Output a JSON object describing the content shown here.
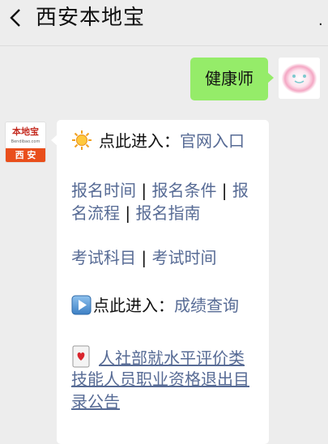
{
  "header": {
    "title": "西安本地宝",
    "more": "."
  },
  "user_message": {
    "text": "健康师"
  },
  "bot_avatar": {
    "name": "本地宝",
    "site": "Bendibao.com",
    "city": "西 安"
  },
  "bot_message": {
    "line1": {
      "prefix": "点此进入：",
      "link": "官网入口"
    },
    "line2": {
      "a": "报名时间",
      "sep1": " | ",
      "b": "报名条件",
      "sep2": " | ",
      "c_part1": "报"
    },
    "line3": {
      "c_part2": "名流程",
      "sep": " | ",
      "d": "报名指南"
    },
    "line4": {
      "a": "考试科目",
      "sep": " | ",
      "b": "考试时间"
    },
    "line5": {
      "prefix": "点此进入：",
      "link": "成绩查询"
    },
    "line6": {
      "l1": "人社部就水平评价类",
      "l2": "技能人员职业资格退出目",
      "l3": "录公告"
    }
  },
  "icons": [
    "back-icon",
    "more-icon",
    "sun-icon",
    "play-icon",
    "card-icon"
  ]
}
